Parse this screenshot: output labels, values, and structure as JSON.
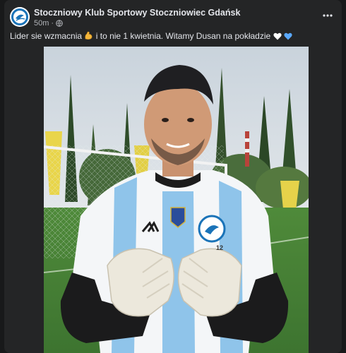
{
  "post": {
    "author": "Stoczniowy Klub Sportowy Stoczniowiec Gdańsk",
    "time": "50m",
    "dot": "·",
    "caption_part1": "Lider sie wzmacnia",
    "caption_part2": "i to nie 1 kwietnia. Witamy Dusan  na pokładzie",
    "jersey_number": "12"
  },
  "icons": {
    "avatar": "club-logo-avatar",
    "privacy": "globe-icon",
    "menu": "more-options-icon",
    "emoji1": "flexed-biceps-emoji",
    "emoji2": "white-heart-emoji",
    "emoji3": "blue-heart-emoji"
  },
  "colors": {
    "background": "#18191a",
    "card": "#242526",
    "text_primary": "#e4e6eb",
    "text_secondary": "#b0b3b8",
    "logo_blue": "#1a73b8"
  }
}
